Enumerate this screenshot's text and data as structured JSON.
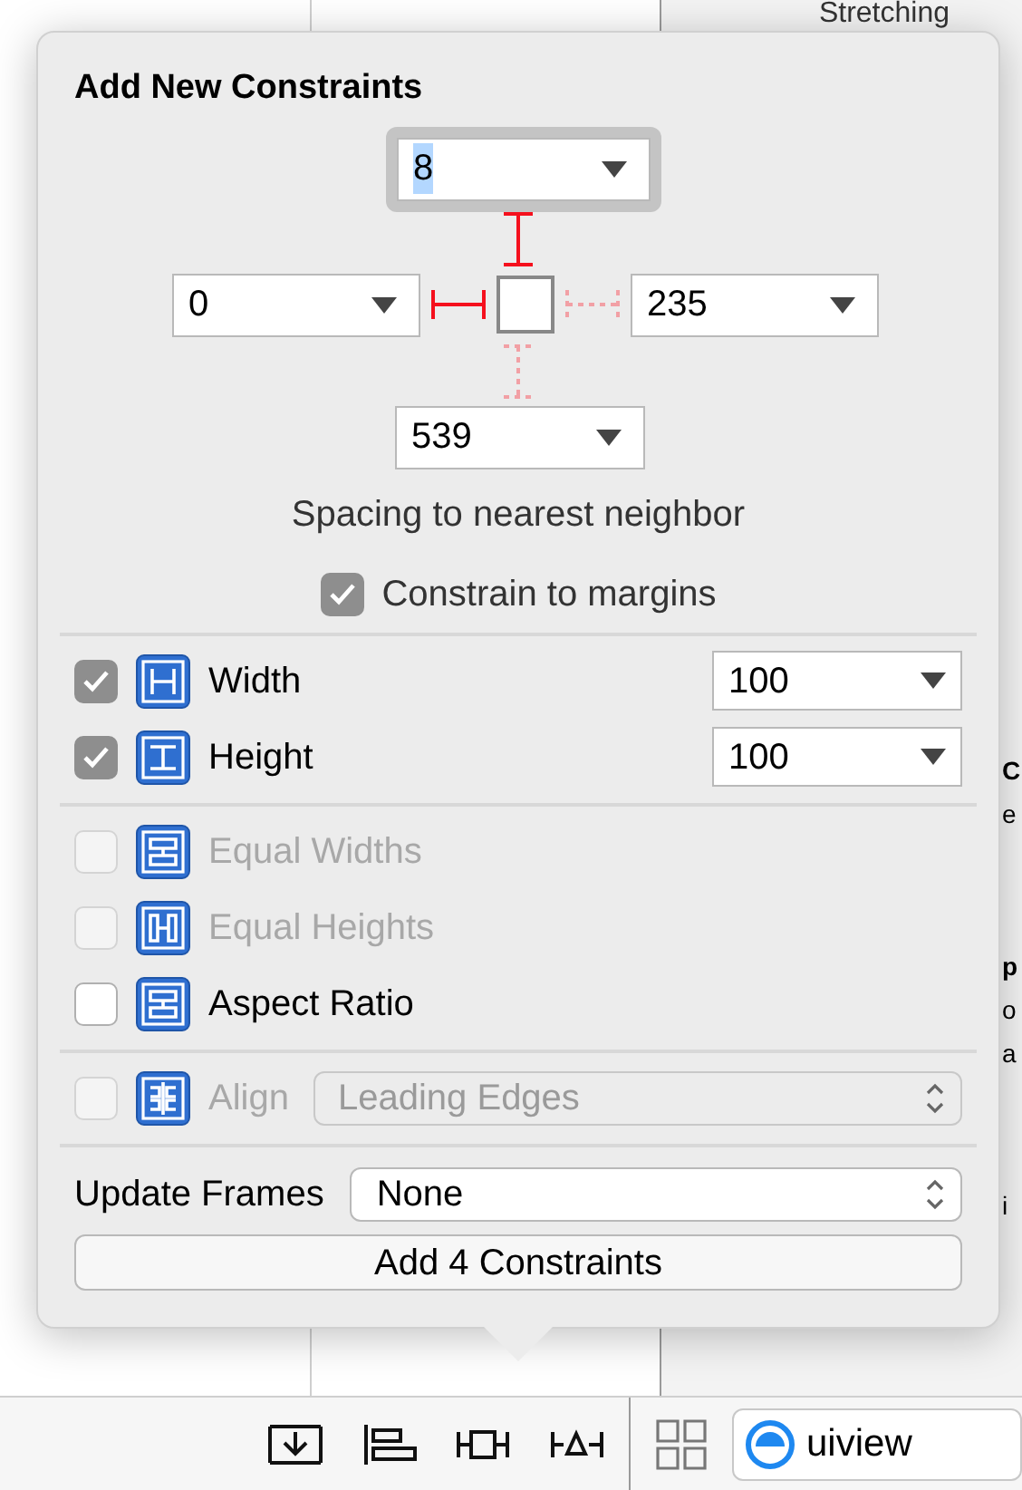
{
  "background": {
    "header": "Stretching",
    "fragments": [
      {
        "text": "C",
        "bold": true
      },
      {
        "text": "e",
        "bold": false
      },
      {
        "text": "p",
        "bold": true
      },
      {
        "text": "o",
        "bold": false
      },
      {
        "text": "a",
        "bold": false
      },
      {
        "text": "i",
        "bold": false
      }
    ]
  },
  "popover": {
    "title": "Add New Constraints",
    "spacing": {
      "top": {
        "value": "8",
        "focused": true,
        "active": true
      },
      "left": {
        "value": "0",
        "focused": false,
        "active": true
      },
      "right": {
        "value": "235",
        "focused": false,
        "active": false
      },
      "bottom": {
        "value": "539",
        "focused": false,
        "active": false
      }
    },
    "caption": "Spacing to nearest neighbor",
    "margins": {
      "label": "Constrain to margins",
      "checked": true
    },
    "size": [
      {
        "label": "Width",
        "checked": true,
        "kind": "width",
        "value": "100"
      },
      {
        "label": "Height",
        "checked": true,
        "kind": "height",
        "value": "100"
      }
    ],
    "relations": [
      {
        "label": "Equal Widths",
        "checked": false,
        "disabled": true,
        "kind": "equal-widths"
      },
      {
        "label": "Equal Heights",
        "checked": false,
        "disabled": true,
        "kind": "equal-heights"
      },
      {
        "label": "Aspect Ratio",
        "checked": false,
        "disabled": false,
        "kind": "aspect"
      }
    ],
    "align": {
      "label": "Align",
      "checked": false,
      "disabled": true,
      "kind": "align",
      "value": "Leading Edges"
    },
    "update_frames": {
      "label": "Update Frames",
      "value": "None"
    },
    "add_button": "Add 4 Constraints"
  },
  "toolbar": {
    "search_value": "uiview"
  }
}
